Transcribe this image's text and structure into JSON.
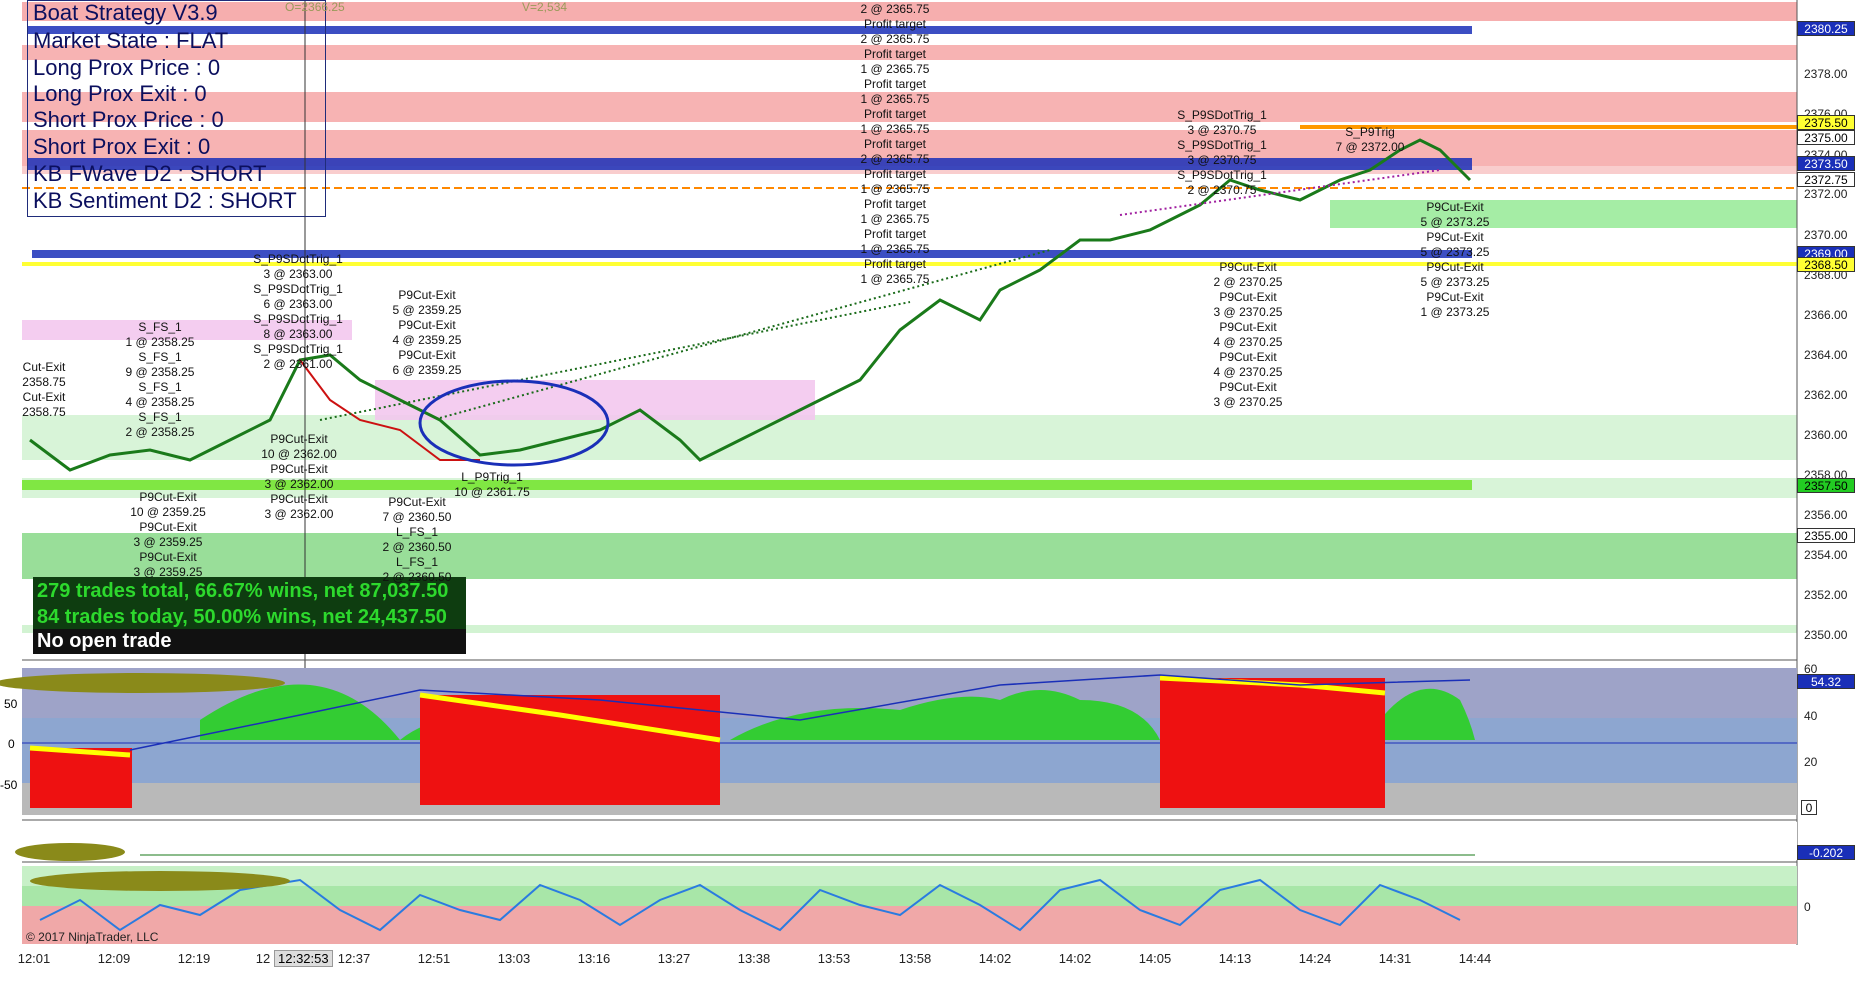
{
  "strategy": {
    "title": "Boat Strategy V3.9",
    "lines": [
      "Market State : FLAT",
      "Long Prox Price : 0",
      "Long Prox Exit : 0",
      "Short Prox Price : 0",
      "Short Prox Exit : 0",
      "KB FWave D2 : SHORT",
      "KB Sentiment D2 : SHORT"
    ]
  },
  "top_readout": {
    "open": "O=2366.25",
    "volume": "V=2,534"
  },
  "stats": {
    "total": "279 trades total, 66.67% wins, net 87,037.50",
    "today": "84 trades today, 50.00% wins, net 24,437.50",
    "open": "No open trade"
  },
  "price_axis": [
    "2378.00",
    "2376.00",
    "2374.00",
    "2372.00",
    "2370.00",
    "2368.00",
    "2366.00",
    "2364.00",
    "2362.00",
    "2360.00",
    "2358.00",
    "2356.00",
    "2354.00",
    "2352.00",
    "2350.00"
  ],
  "price_tags": [
    {
      "label": "2380.25",
      "bg": "#1a2fb8",
      "fg": "#ffffff"
    },
    {
      "label": "2375.50",
      "bg": "#ffff33",
      "fg": "#000000"
    },
    {
      "label": "2375.00",
      "bg": "#ffffff",
      "fg": "#000000"
    },
    {
      "label": "2373.50",
      "bg": "#1a2fb8",
      "fg": "#ffffff"
    },
    {
      "label": "2372.75",
      "bg": "#ffffff",
      "fg": "#000000"
    },
    {
      "label": "2369.00",
      "bg": "#1a2fb8",
      "fg": "#ffffff"
    },
    {
      "label": "2368.50",
      "bg": "#ffff33",
      "fg": "#000000"
    },
    {
      "label": "2357.50",
      "bg": "#22cc22",
      "fg": "#000000"
    },
    {
      "label": "2355.00",
      "bg": "#ffffff",
      "fg": "#000000"
    }
  ],
  "osc1": {
    "axis": [
      "60",
      "40",
      "20"
    ],
    "left_axis": [
      "50",
      "0",
      "-50"
    ],
    "value": "54.32",
    "zero": "0"
  },
  "osc2": {
    "value": "-0.202"
  },
  "osc3": {
    "axis": [
      "0"
    ]
  },
  "time_axis": [
    "12:01",
    "12:09",
    "12:19",
    "12",
    "12:37",
    "12:51",
    "13:03",
    "13:16",
    "13:27",
    "13:38",
    "13:53",
    "13:58",
    "14:02",
    "14:02",
    "14:05",
    "14:13",
    "14:24",
    "14:31",
    "14:44"
  ],
  "cursor_time": "12:32:53",
  "copyright": "© 2017 NinjaTrader, LLC",
  "annotations": [
    {
      "text": "2 @ 2365.75\nProfit target\n2 @ 2365.75\nProfit target\n1 @ 2365.75\nProfit target\n1 @ 2365.75\nProfit target\n1 @ 2365.75\nProfit target\n2 @ 2365.75\nProfit target\n1 @ 2365.75\nProfit target\n1 @ 2365.75\nProfit target\n1 @ 2365.75\nProfit target\n1 @ 2365.75"
    },
    {
      "text": "S_P9SDotTrig_1\n3 @ 2370.75\nS_P9SDotTrig_1\n3 @ 2370.75\nS_P9SDotTrig_1\n2 @ 2370.75"
    },
    {
      "text": "S_P9Trig\n7 @ 2372.00"
    },
    {
      "text": "P9Cut-Exit\n5 @ 2373.25\nP9Cut-Exit\n5 @ 2373.25\nP9Cut-Exit\n5 @ 2373.25\nP9Cut-Exit\n1 @ 2373.25"
    },
    {
      "text": "P9Cut-Exit\n2 @ 2370.25\nP9Cut-Exit\n3 @ 2370.25\nP9Cut-Exit\n4 @ 2370.25\nP9Cut-Exit\n4 @ 2370.25\nP9Cut-Exit\n3 @ 2370.25"
    },
    {
      "text": "S_P9SDotTrig_1\n3 @ 2363.00\nS_P9SDotTrig_1\n6 @ 2363.00\nS_P9SDotTrig_1\n8 @ 2363.00\nS_P9SDotTrig_1\n2 @ 2361.00"
    },
    {
      "text": "P9Cut-Exit\n5 @ 2359.25\nP9Cut-Exit\n4 @ 2359.25\nP9Cut-Exit\n6 @ 2359.25"
    },
    {
      "text": "S_FS_1\n1 @ 2358.25\nS_FS_1\n9 @ 2358.25\nS_FS_1\n4 @ 2358.25\nS_FS_1\n2 @ 2358.25"
    },
    {
      "text": "Cut-Exit\n2358.75\nCut-Exit\n2358.75"
    },
    {
      "text": "P9Cut-Exit\n10 @ 2362.00\nP9Cut-Exit\n3 @ 2362.00\nP9Cut-Exit\n3 @ 2362.00"
    },
    {
      "text": "P9Cut-Exit\n10 @ 2359.25\nP9Cut-Exit\n3 @ 2359.25\nP9Cut-Exit\n3 @ 2359.25"
    },
    {
      "text": "P9Cut-Exit\n7 @ 2360.50\nL_FS_1\n2 @ 2360.50\nL_FS_1\n2 @ 2360.50"
    },
    {
      "text": "L_P9Trig_1\n10 @ 2361.75"
    }
  ]
}
